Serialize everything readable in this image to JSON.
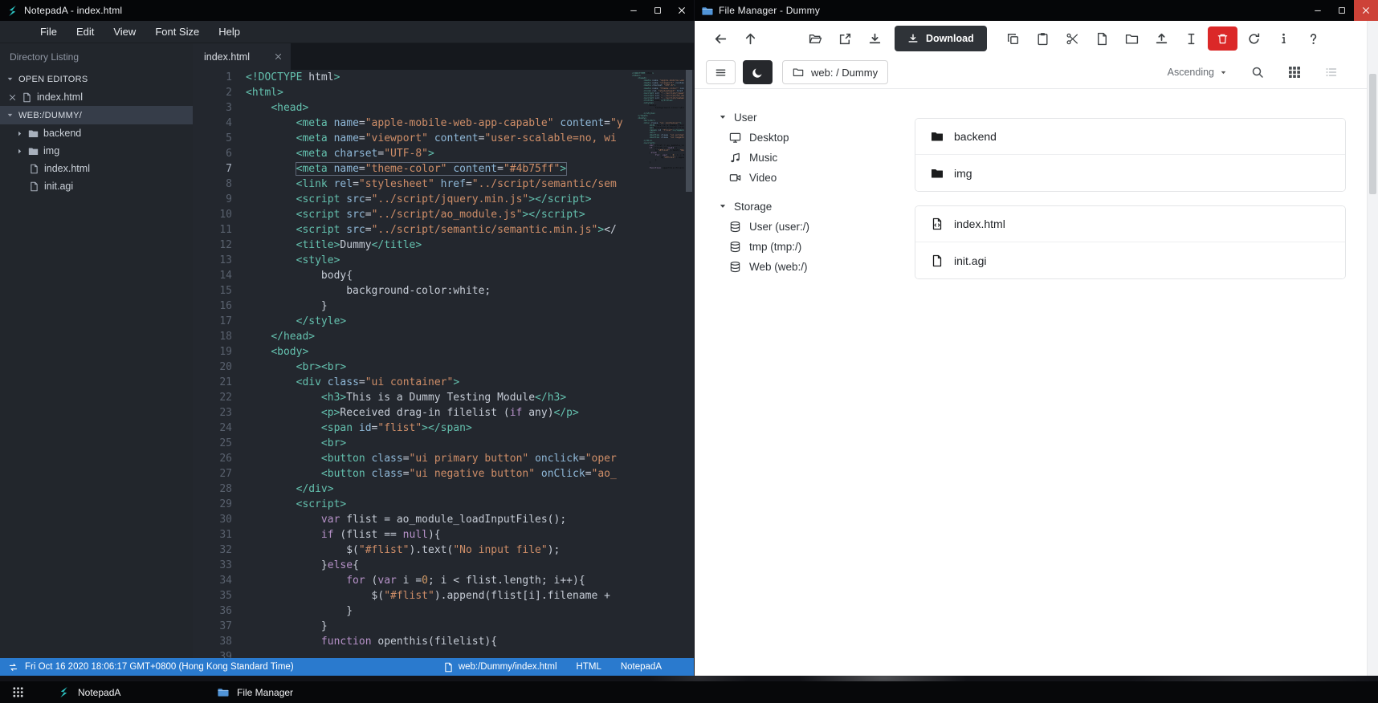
{
  "colors": {
    "statusbar_blue": "#2a7ace",
    "delete_red": "#db2828",
    "download_button_dark": "#2f3338",
    "notepada_teal": "#2bc0bf",
    "filemanager_blue": "#5094d8"
  },
  "notepad": {
    "title": "NotepadA - index.html",
    "menu": [
      "File",
      "Edit",
      "View",
      "Font Size",
      "Help"
    ],
    "sidebar": {
      "header": "Directory Listing",
      "open_editors_label": "OPEN EDITORS",
      "open_editors": [
        "index.html"
      ],
      "workspace_label": "WEB:/DUMMY/",
      "tree": [
        {
          "name": "backend",
          "type": "folder",
          "icon": "folder-solid-icon"
        },
        {
          "name": "img",
          "type": "folder",
          "icon": "folder-solid-icon"
        },
        {
          "name": "index.html",
          "type": "file",
          "icon": "file-icon"
        },
        {
          "name": "init.agi",
          "type": "file",
          "icon": "file-icon"
        }
      ]
    },
    "editor": {
      "tab": "index.html",
      "active_line": 7,
      "lines": [
        "<!DOCTYPE html>",
        "<html>",
        "    <head>",
        "        <meta name=\"apple-mobile-web-app-capable\" content=\"y",
        "        <meta name=\"viewport\" content=\"user-scalable=no, wi",
        "        <meta charset=\"UTF-8\">",
        "        <meta name=\"theme-color\" content=\"#4b75ff\">",
        "        <link rel=\"stylesheet\" href=\"../script/semantic/sem",
        "        <script src=\"../script/jquery.min.js\"></script>",
        "        <script src=\"../script/ao_module.js\"></script>",
        "        <script src=\"../script/semantic/semantic.min.js\"></",
        "        <title>Dummy</title>",
        "        <style>",
        "            body{",
        "                background-color:white;",
        "            }",
        "        </style>",
        "    </head>",
        "    <body>",
        "        <br><br>",
        "        <div class=\"ui container\">",
        "            <h3>This is a Dummy Testing Module</h3>",
        "            <p>Received drag-in filelist (if any)</p>",
        "            <span id=\"flist\"></span>",
        "            <br>",
        "            <button class=\"ui primary button\" onclick=\"oper",
        "            <button class=\"ui negative button\" onClick=\"ao_",
        "        </div>",
        "        <script>",
        "            var flist = ao_module_loadInputFiles();",
        "            if (flist == null){",
        "                $(\"#flist\").text(\"No input file\");",
        "            }else{",
        "                for (var i =0; i < flist.length; i++){",
        "                    $(\"#flist\").append(flist[i].filename + ",
        "                }",
        "            }",
        "",
        "            function openthis(filelist){"
      ]
    },
    "statusbar": {
      "clock": "Fri Oct 16 2020 18:06:17 GMT+0800 (Hong Kong Standard Time)",
      "file": "web:/Dummy/index.html",
      "language": "HTML",
      "app_name": "NotepadA"
    }
  },
  "filemanager": {
    "title": "File Manager - Dummy",
    "toolbar": [
      {
        "name": "back",
        "icon": "arrow-left-icon"
      },
      {
        "name": "up",
        "icon": "arrow-up-icon"
      },
      {
        "name": "open",
        "icon": "folder-open-icon",
        "gap": true
      },
      {
        "name": "open-in-new-window",
        "icon": "external-link-icon"
      },
      {
        "name": "save-to-device",
        "icon": "download-icon"
      },
      {
        "name": "download",
        "icon": "download-icon",
        "label": "Download",
        "style": "dark"
      },
      {
        "name": "copy",
        "icon": "copy-icon"
      },
      {
        "name": "paste",
        "icon": "paste-icon"
      },
      {
        "name": "cut",
        "icon": "scissors-icon"
      },
      {
        "name": "new-file",
        "icon": "file-icon"
      },
      {
        "name": "new-folder",
        "icon": "folder-icon"
      },
      {
        "name": "upload",
        "icon": "upload-icon"
      },
      {
        "name": "rename",
        "icon": "i-cursor-icon"
      },
      {
        "name": "delete",
        "icon": "trash-icon",
        "style": "danger"
      },
      {
        "name": "refresh",
        "icon": "refresh-icon"
      },
      {
        "name": "properties",
        "icon": "info-icon"
      },
      {
        "name": "help",
        "icon": "question-icon"
      }
    ],
    "breadcrumb": "web: / Dummy",
    "sort_label": "Ascending",
    "sidebar": {
      "sections": [
        {
          "label": "User",
          "items": [
            {
              "label": "Desktop",
              "icon": "desktop-icon"
            },
            {
              "label": "Music",
              "icon": "music-icon"
            },
            {
              "label": "Video",
              "icon": "video-icon"
            }
          ]
        },
        {
          "label": "Storage",
          "items": [
            {
              "label": "User (user:/)",
              "icon": "drive-icon"
            },
            {
              "label": "tmp (tmp:/)",
              "icon": "drive-icon"
            },
            {
              "label": "Web (web:/)",
              "icon": "drive-icon"
            }
          ]
        }
      ]
    },
    "file_groups": [
      {
        "items": [
          {
            "name": "backend",
            "icon": "folder-solid-icon"
          },
          {
            "name": "img",
            "icon": "folder-solid-icon"
          }
        ]
      },
      {
        "items": [
          {
            "name": "index.html",
            "icon": "file-code-icon"
          },
          {
            "name": "init.agi",
            "icon": "file-icon"
          }
        ]
      }
    ]
  },
  "taskbar": {
    "items": [
      {
        "label": "NotepadA",
        "icon": "notepada-logo"
      },
      {
        "label": "File Manager",
        "icon": "filemanager-logo"
      }
    ]
  }
}
